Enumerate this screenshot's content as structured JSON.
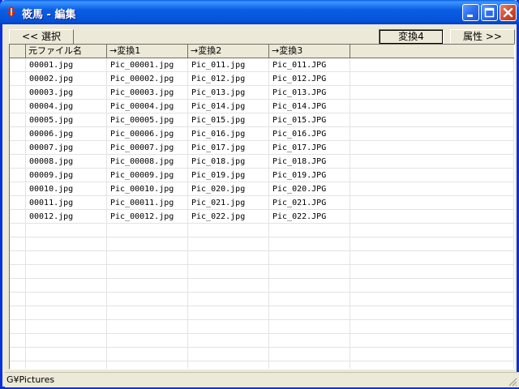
{
  "window": {
    "title": "筱馬 - 編集",
    "colors": {
      "titlebar": "#0a5fe4",
      "frame": "#0831d9",
      "face": "#ece9d8"
    },
    "icons": [
      "app-icon",
      "minimize-icon",
      "maximize-icon",
      "close-icon"
    ]
  },
  "toolbar": {
    "select_label": "<< 選択",
    "convert4_label": "変換4",
    "attributes_label": "属性 >>"
  },
  "table": {
    "columns": [
      "元ファイル名",
      "→変換1",
      "→変換2",
      "→変換3",
      ""
    ],
    "rows": [
      [
        "00001.jpg",
        "Pic_00001.jpg",
        "Pic_011.jpg",
        "Pic_011.JPG"
      ],
      [
        "00002.jpg",
        "Pic_00002.jpg",
        "Pic_012.jpg",
        "Pic_012.JPG"
      ],
      [
        "00003.jpg",
        "Pic_00003.jpg",
        "Pic_013.jpg",
        "Pic_013.JPG"
      ],
      [
        "00004.jpg",
        "Pic_00004.jpg",
        "Pic_014.jpg",
        "Pic_014.JPG"
      ],
      [
        "00005.jpg",
        "Pic_00005.jpg",
        "Pic_015.jpg",
        "Pic_015.JPG"
      ],
      [
        "00006.jpg",
        "Pic_00006.jpg",
        "Pic_016.jpg",
        "Pic_016.JPG"
      ],
      [
        "00007.jpg",
        "Pic_00007.jpg",
        "Pic_017.jpg",
        "Pic_017.JPG"
      ],
      [
        "00008.jpg",
        "Pic_00008.jpg",
        "Pic_018.jpg",
        "Pic_018.JPG"
      ],
      [
        "00009.jpg",
        "Pic_00009.jpg",
        "Pic_019.jpg",
        "Pic_019.JPG"
      ],
      [
        "00010.jpg",
        "Pic_00010.jpg",
        "Pic_020.jpg",
        "Pic_020.JPG"
      ],
      [
        "00011.jpg",
        "Pic_00011.jpg",
        "Pic_021.jpg",
        "Pic_021.JPG"
      ],
      [
        "00012.jpg",
        "Pic_00012.jpg",
        "Pic_022.jpg",
        "Pic_022.JPG"
      ]
    ]
  },
  "status": {
    "path": "G¥Pictures"
  }
}
